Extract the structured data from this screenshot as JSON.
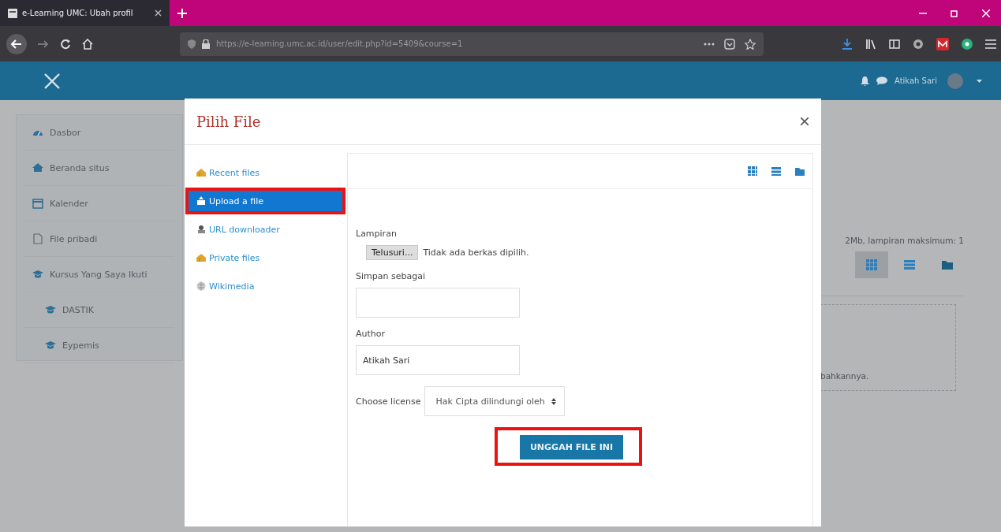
{
  "browser": {
    "tab_title": "e-Learning UMC: Ubah profil",
    "url": "https://e-learning.umc.ac.id/user/edit.php?id=5409&course=1"
  },
  "header": {
    "user_name": "Atikah Sari"
  },
  "sidebar": {
    "items": [
      {
        "label": "Dasbor"
      },
      {
        "label": "Beranda situs"
      },
      {
        "label": "Kalender"
      },
      {
        "label": "File pribadi"
      },
      {
        "label": "Kursus Yang Saya Ikuti",
        "children": [
          {
            "label": "DASTIK"
          },
          {
            "label": "Eypemis"
          }
        ]
      }
    ]
  },
  "background_form": {
    "note": "2Mb, lampiran maksimum: 1",
    "view_buttons": [
      {
        "selected": true
      },
      {
        "selected": false
      },
      {
        "selected": false
      }
    ],
    "drop_text": "bahkannya."
  },
  "dialog": {
    "title": "Pilih File",
    "repositories": [
      {
        "label": "Recent files",
        "selected": false,
        "highlighted": false
      },
      {
        "label": "Upload a file",
        "selected": true,
        "highlighted": true
      },
      {
        "label": "URL downloader",
        "selected": false,
        "highlighted": false
      },
      {
        "label": "Private files",
        "selected": false,
        "highlighted": false
      },
      {
        "label": "Wikimedia",
        "selected": false,
        "highlighted": false
      }
    ],
    "fields": [
      {
        "kind": "file",
        "label": "Lampiran",
        "button": "Telusuri...",
        "status": "Tidak ada berkas dipilih."
      },
      {
        "kind": "text",
        "label": "Simpan sebagai"
      },
      {
        "kind": "text",
        "label": "Author",
        "value": "Atikah Sari"
      },
      {
        "kind": "select",
        "label": "Choose license",
        "value": "Hak Cipta dilindungi oleh"
      }
    ],
    "submit": {
      "label": "UNGGAH FILE INI",
      "highlighted": true
    }
  }
}
